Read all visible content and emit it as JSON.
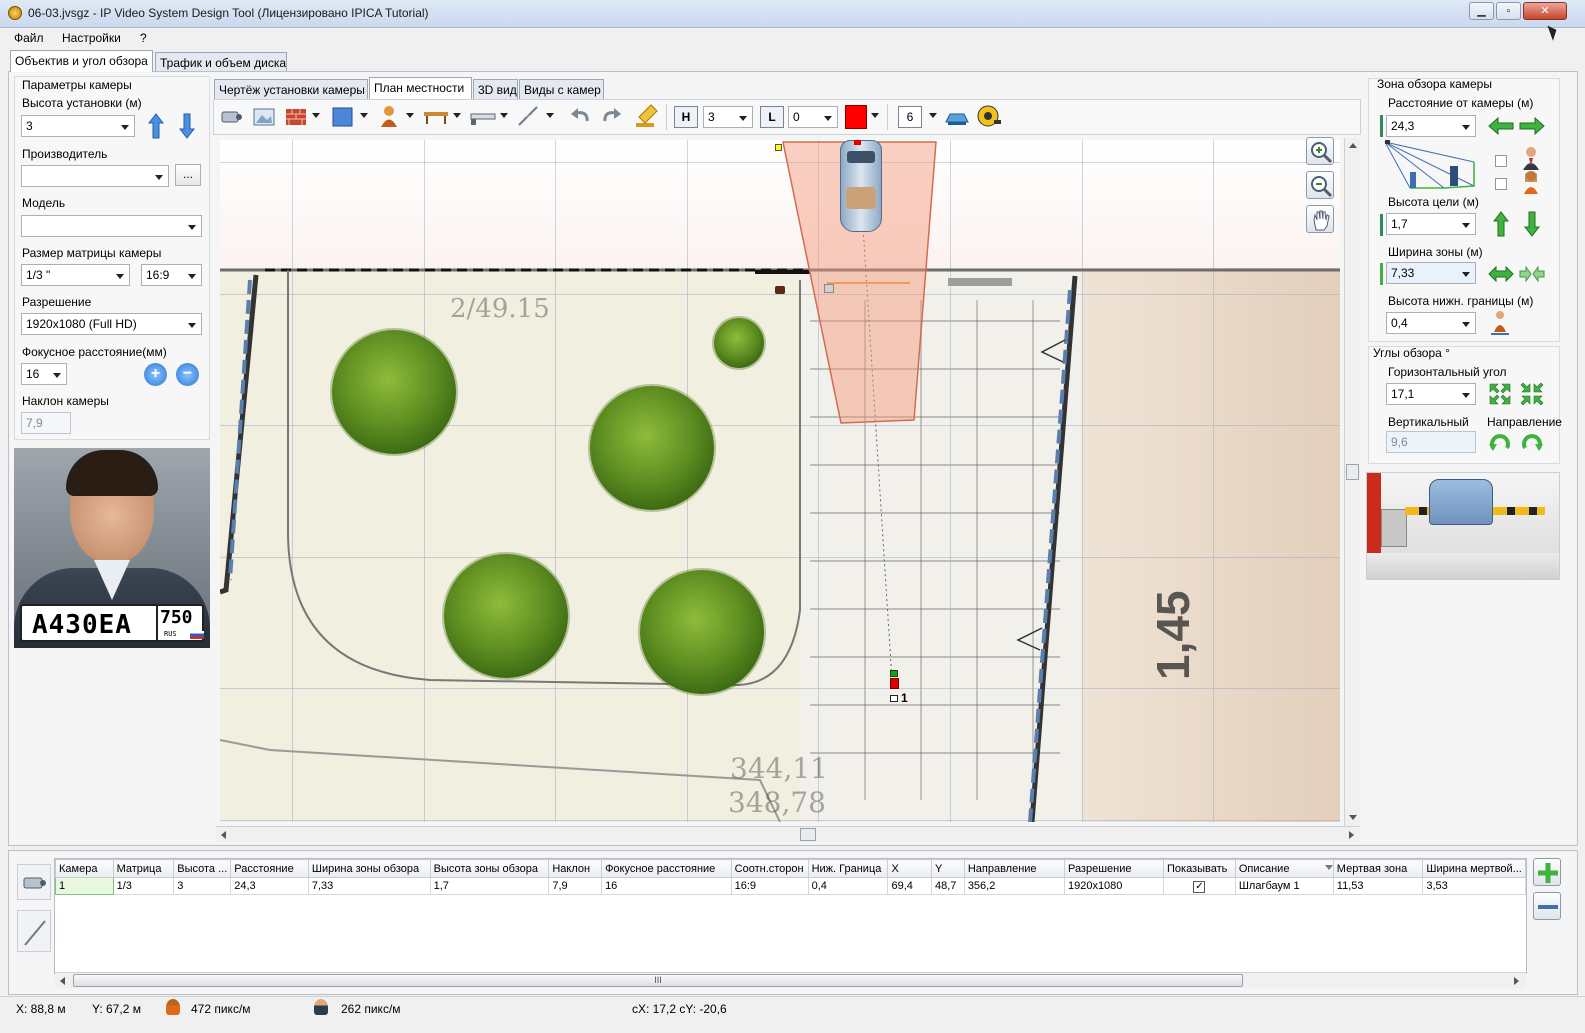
{
  "window": {
    "title": "06-03.jvsgz - IP Video System Design Tool (Лицензировано  IPICA Tutorial)"
  },
  "menu": [
    "Файл",
    "Настройки",
    "?"
  ],
  "main_tabs": [
    "Объектив и угол обзора",
    "Трафик и объем диска"
  ],
  "left": {
    "group_title": "Параметры камеры",
    "height_label": "Высота установки (м)",
    "height_value": "3",
    "maker_label": "Производитель",
    "maker_value": "",
    "maker_browse": "...",
    "model_label": "Модель",
    "model_value": "",
    "sensor_label": "Размер матрицы камеры",
    "sensor_value": "1/3 \"",
    "aspect_value": "16:9",
    "resolution_label": "Разрешение",
    "resolution_value": "1920x1080 (Full HD)",
    "focal_label": "Фокусное расстояние(мм)",
    "focal_value": "16",
    "tilt_label": "Наклон камеры",
    "tilt_value": "7,9",
    "plate_text": "A430EA",
    "plate_region": "750",
    "plate_country": "RUS"
  },
  "view_tabs": [
    "Чертёж установки камеры",
    "План местности",
    "3D вид",
    "Виды с камер"
  ],
  "toolbar": {
    "h_label": "H",
    "h_value": "3",
    "l_label": "L",
    "l_value": "0",
    "color": "#ff0000",
    "layer_value": "6"
  },
  "map": {
    "camera_label": "1",
    "texts": [
      "2/49.15",
      "1,45",
      "344,11",
      "348,78"
    ]
  },
  "right": {
    "zone_title": "Зона обзора камеры",
    "distance_label": "Расстояние от камеры (м)",
    "distance_value": "24,3",
    "target_height_label": "Высота цели (м)",
    "target_height_value": "1,7",
    "zone_width_label": "Ширина зоны (м)",
    "zone_width_value": "7,33",
    "lower_bound_label": "Высота нижн. границы (м)",
    "lower_bound_value": "0,4",
    "angles_title": "Углы обзора °",
    "horiz_label": "Горизонтальный угол",
    "horiz_value": "17,1",
    "vert_label": "Вертикальный",
    "vert_value": "9,6",
    "direction_label": "Направление"
  },
  "table": {
    "headers": [
      "Камера",
      "Матрица",
      "Высота ...",
      "Расстояние",
      "Ширина зоны обзора",
      "Высота зоны обзора",
      "Наклон",
      "Фокусное расстояние",
      "Соотн.сторон",
      "Ниж. Граница",
      "X",
      "Y",
      "Направление",
      "Разрешение",
      "Показывать",
      "Описание",
      "Мертвая зона",
      "Ширина мертвой..."
    ],
    "row": [
      "1",
      "1/3",
      "3",
      "24,3",
      "7,33",
      "1,7",
      "7,9",
      "16",
      "16:9",
      "0,4",
      "69,4",
      "48,7",
      "356,2",
      "1920x1080",
      "",
      "Шлагбаум 1",
      "11,53",
      "3,53"
    ],
    "show_checked": true,
    "scroll_label": "III"
  },
  "status": {
    "x": "X: 88,8 м",
    "y": "Y: 67,2 м",
    "px1": "472 пикс/м",
    "px2": "262 пикс/м",
    "cxy": "cX: 17,2 cY: -20,6"
  }
}
